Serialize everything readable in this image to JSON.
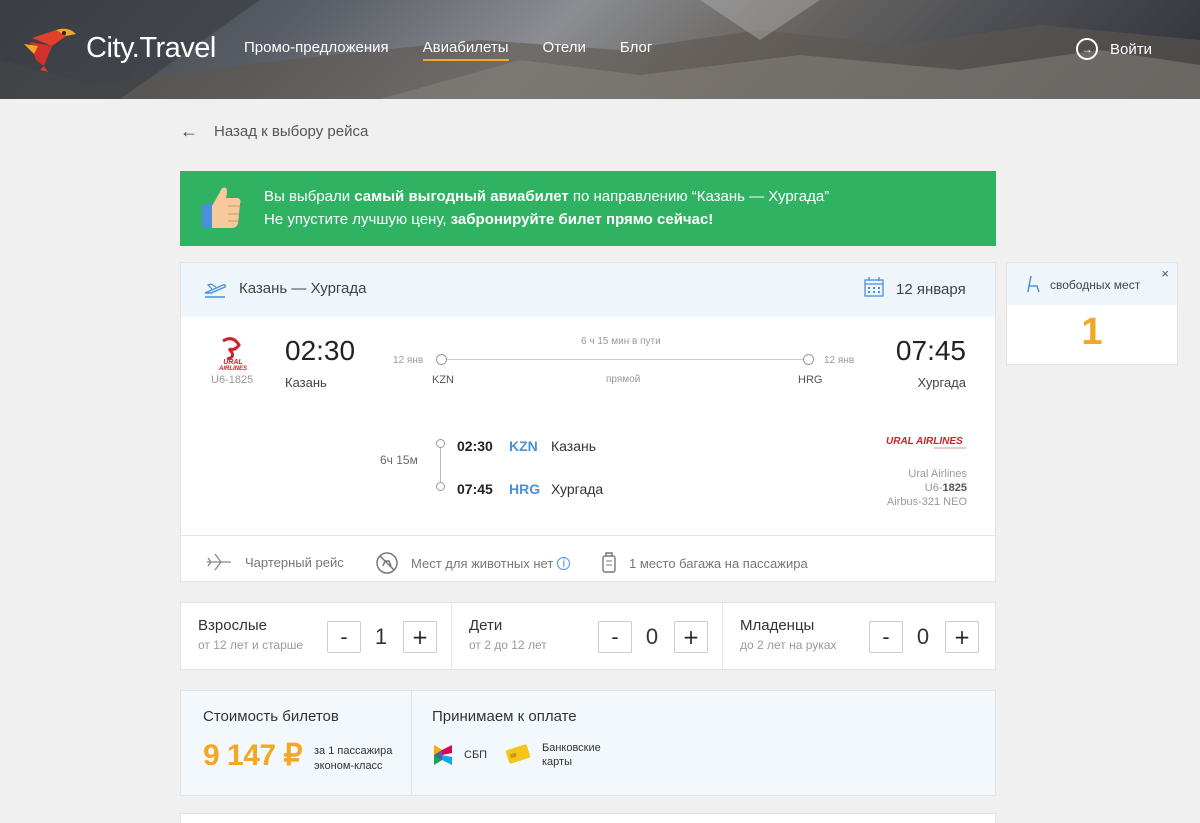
{
  "header": {
    "logo_text": "City.Travel",
    "nav": [
      {
        "label": "Промо-предложения",
        "active": false
      },
      {
        "label": "Авиабилеты",
        "active": true
      },
      {
        "label": "Отели",
        "active": false
      },
      {
        "label": "Блог",
        "active": false
      }
    ],
    "login_label": "Войти"
  },
  "back_label": "Назад к выбору рейса",
  "banner": {
    "line1_pre": "Вы выбрали ",
    "line1_bold": "самый выгодный авиабилет",
    "line1_post": " по направлению “Казань — Хургада”",
    "line2_pre": "Не упустите лучшую цену, ",
    "line2_bold": "забронируйте билет прямо сейчас!"
  },
  "flight": {
    "route": "Казань — Хургада",
    "date": "12 января",
    "airline_logo_text": "URAL AIRLINES",
    "flight_number": "U6-1825",
    "dep_time": "02:30",
    "dep_city": "Казань",
    "arr_time": "07:45",
    "arr_city": "Хургада",
    "duration_label": "6 ч 15 мин в пути",
    "dep_date_small": "12 янв",
    "arr_date_small": "12 янв",
    "dep_code": "KZN",
    "arr_code": "HRG",
    "direct_label": "прямой",
    "segment": {
      "duration": "6ч 15м",
      "dep_time": "02:30",
      "dep_code": "KZN",
      "dep_city": "Казань",
      "arr_time": "07:45",
      "arr_code": "HRG",
      "arr_city": "Хургада",
      "airline_name": "Ural Airlines",
      "flight_prefix": "U6-",
      "flight_num": "1825",
      "aircraft": "Airbus-321 NEO"
    },
    "features": [
      {
        "icon": "charter-plane-icon",
        "label": "Чартерный рейс"
      },
      {
        "icon": "no-pets-icon",
        "label": "Мест для животных нет"
      },
      {
        "icon": "baggage-icon",
        "label": "1 место багажа на пассажира"
      }
    ]
  },
  "seats": {
    "label": "свободных мест",
    "count": "1",
    "close": "×"
  },
  "passengers": [
    {
      "title": "Взрослые",
      "sub": "от 12 лет и старше",
      "count": "1"
    },
    {
      "title": "Дети",
      "sub": "от 2 до 12 лет",
      "count": "0"
    },
    {
      "title": "Младенцы",
      "sub": "до 2 лет на руках",
      "count": "0"
    }
  ],
  "stepper": {
    "minus": "-",
    "plus": "+"
  },
  "price": {
    "title": "Стоимость билетов",
    "value": "9 147 ₽",
    "note1": "за 1 пассажира",
    "note2": "эконом-класс"
  },
  "payment": {
    "title": "Принимаем к оплате",
    "methods": [
      {
        "icon": "sbp-icon",
        "label1": "СБП",
        "label2": ""
      },
      {
        "icon": "bank-card-icon",
        "label1": "Банковские",
        "label2": "карты"
      }
    ]
  },
  "colors": {
    "accent": "#f5a623",
    "green": "#2fb262",
    "blue": "#4a90d9"
  }
}
